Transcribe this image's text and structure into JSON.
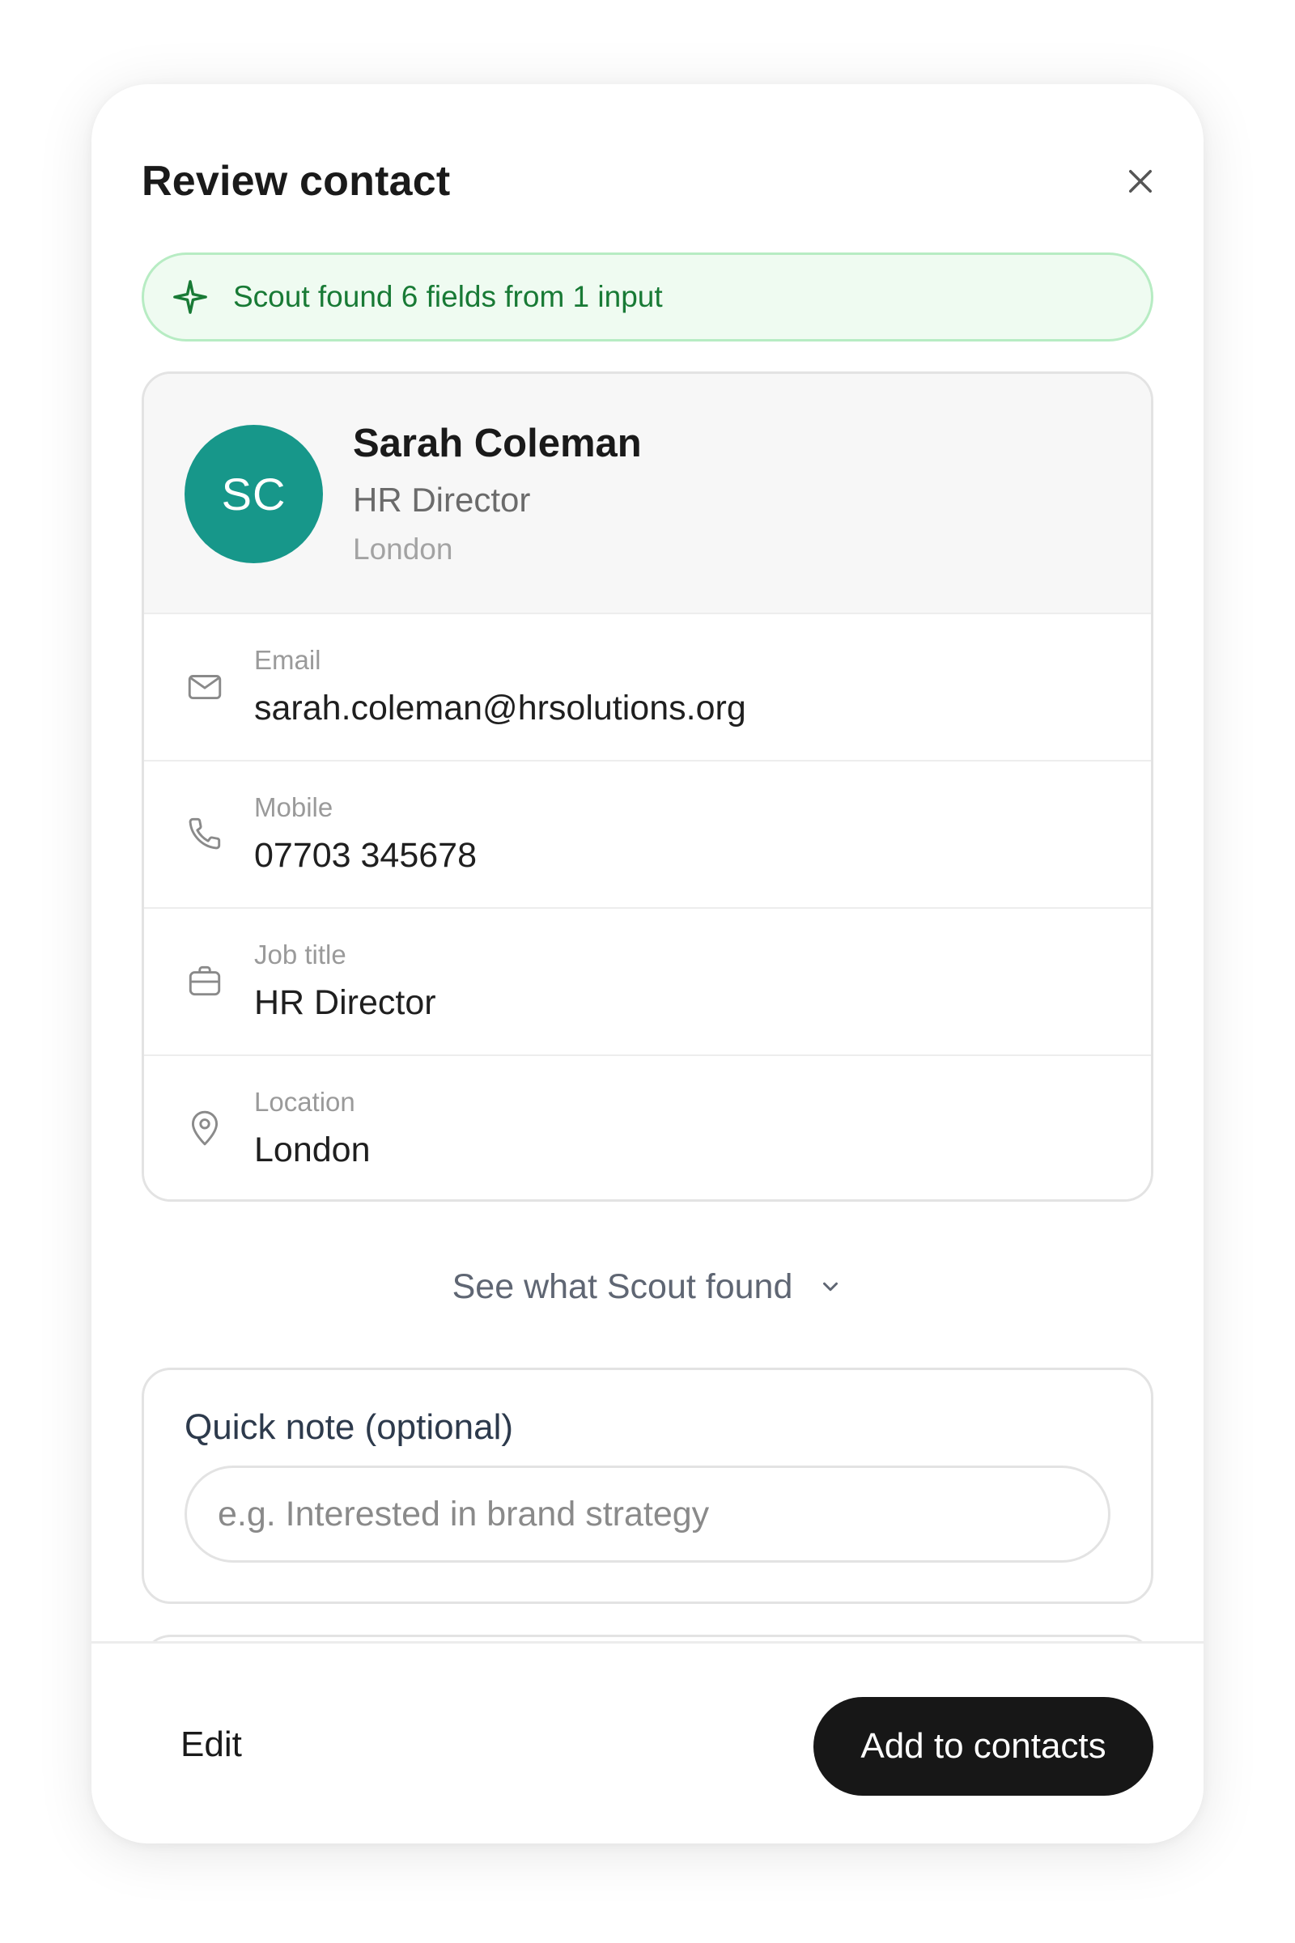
{
  "modal": {
    "title": "Review contact"
  },
  "banner": {
    "icon": "sparkle-icon",
    "text": "Scout found 6 fields from 1 input",
    "color": "#187a35",
    "background": "#effbf1"
  },
  "contact": {
    "initials": "SC",
    "avatar_color": "#17978a",
    "name": "Sarah Coleman",
    "title": "HR Director",
    "location": "London"
  },
  "fields": [
    {
      "icon": "mail-icon",
      "label": "Email",
      "value": "sarah.coleman@hrsolutions.org"
    },
    {
      "icon": "phone-icon",
      "label": "Mobile",
      "value": "07703 345678"
    },
    {
      "icon": "briefcase-icon",
      "label": "Job title",
      "value": "HR Director"
    },
    {
      "icon": "location-pin-icon",
      "label": "Location",
      "value": "London"
    }
  ],
  "see_found": {
    "label": "See what Scout found",
    "icon": "chevron-down-icon"
  },
  "note": {
    "label": "Quick note (optional)",
    "placeholder": "e.g. Interested in brand strategy",
    "value": ""
  },
  "footer": {
    "edit_label": "Edit",
    "add_label": "Add to contacts"
  }
}
